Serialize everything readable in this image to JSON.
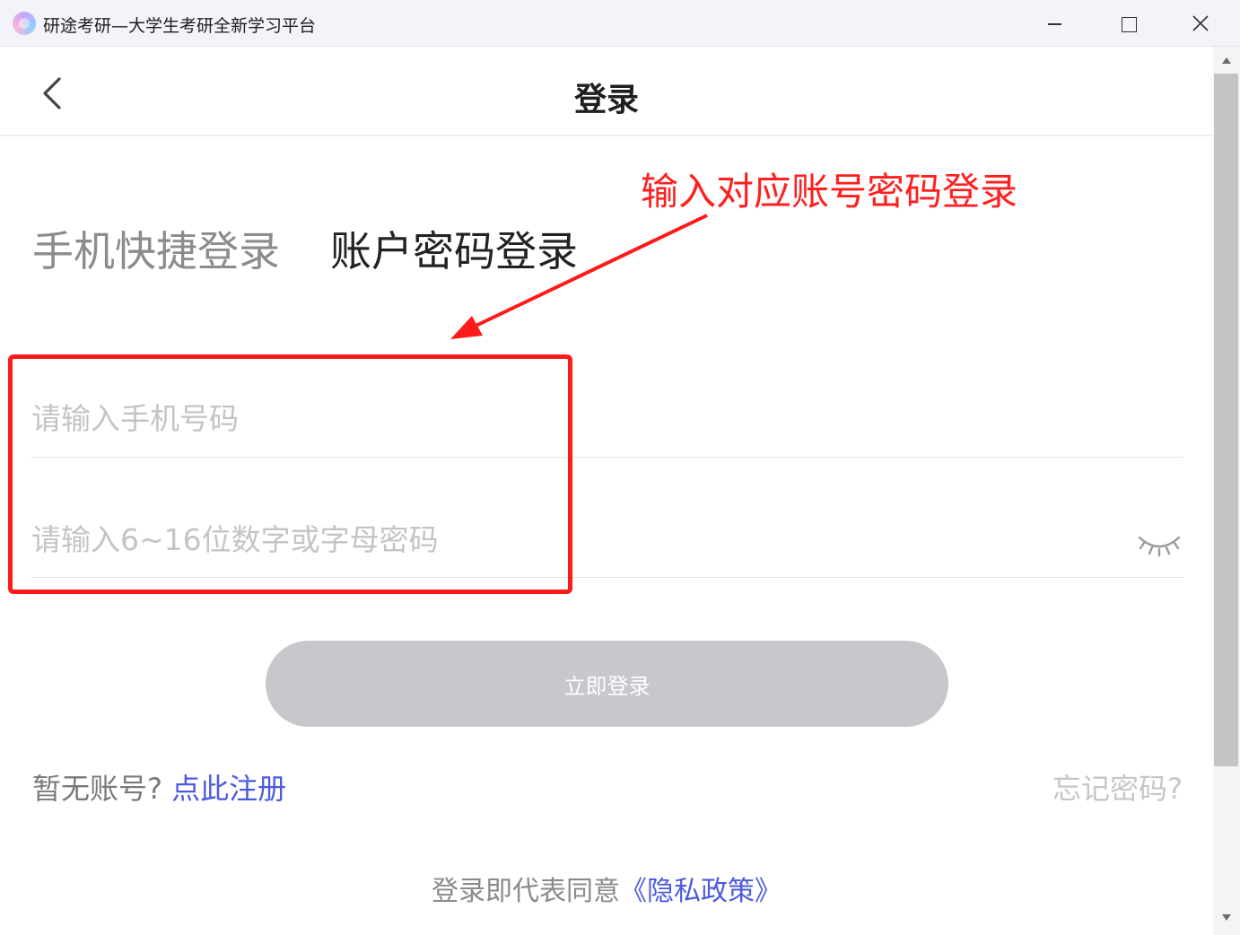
{
  "window": {
    "title": "研途考研—大学生考研全新学习平台"
  },
  "header": {
    "title": "登录"
  },
  "tabs": [
    {
      "label": "手机快捷登录",
      "active": false
    },
    {
      "label": "账户密码登录",
      "active": true
    }
  ],
  "form": {
    "phone_placeholder": "请输入手机号码",
    "phone_value": "",
    "password_placeholder": "请输入6~16位数字或字母密码",
    "password_value": "",
    "password_toggle_icon": "eye-closed-icon",
    "submit_label": "立即登录"
  },
  "links": {
    "no_account_text": "暂无账号?",
    "register_label": "点此注册",
    "forgot_label": "忘记密码?",
    "privacy_prefix": "登录即代表同意",
    "privacy_link": "《隐私政策》"
  },
  "annotation": {
    "text": "输入对应账号密码登录",
    "color": "#ff1a1a"
  },
  "colors": {
    "link": "#4b5bdc",
    "button_disabled": "#c6c8cc"
  }
}
